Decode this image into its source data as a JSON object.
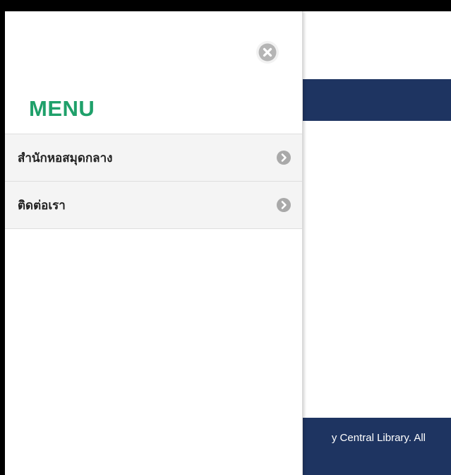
{
  "drawer": {
    "title": "MENU",
    "close_icon": "close-circle-icon",
    "items": [
      {
        "label": "สำนักหอสมุดกลาง",
        "icon": "chevron-right-circle-icon"
      },
      {
        "label": "ติดต่อเรา",
        "icon": "chevron-right-circle-icon"
      }
    ]
  },
  "page": {
    "footer_text": "y Central Library. All"
  },
  "colors": {
    "accent": "#1fa06a",
    "navbar": "#1e3461",
    "item_background": "#f4f4f4",
    "icon_gray": "#a9a9a9"
  }
}
